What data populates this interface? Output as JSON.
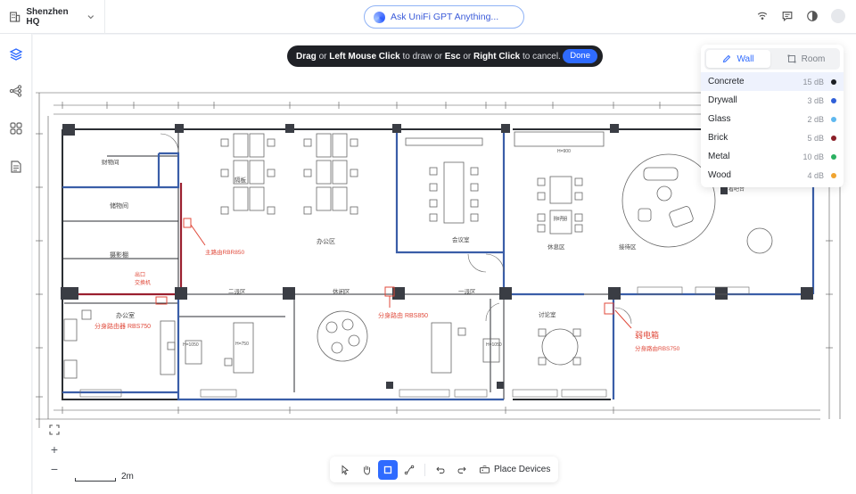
{
  "header": {
    "site_name": "Shenzhen HQ",
    "assistant_placeholder": "Ask UniFi GPT Anything...",
    "icons": [
      "building-icon",
      "chevron-down-icon",
      "signal-icon",
      "chat-icon",
      "theme-icon",
      "avatar"
    ]
  },
  "hint": {
    "part1": "Drag",
    "part2": " or ",
    "part3": "Left Mouse Click",
    "part4": " to draw or ",
    "part5": "Esc",
    "part6": " or ",
    "part7": "Right Click",
    "part8": " to cancel.",
    "done_label": "Done"
  },
  "panel": {
    "tabs": [
      {
        "label": "Wall",
        "icon": "pencil-icon",
        "active": true
      },
      {
        "label": "Room",
        "icon": "room-icon",
        "active": false
      }
    ],
    "materials": [
      {
        "name": "Concrete",
        "db": "15 dB",
        "color": "#1c1f24",
        "selected": true
      },
      {
        "name": "Drywall",
        "db": "3 dB",
        "color": "#2f5fd8",
        "selected": false
      },
      {
        "name": "Glass",
        "db": "2 dB",
        "color": "#5fb8ef",
        "selected": false
      },
      {
        "name": "Brick",
        "db": "5 dB",
        "color": "#8b1f28",
        "selected": false
      },
      {
        "name": "Metal",
        "db": "10 dB",
        "color": "#2bb061",
        "selected": false
      },
      {
        "name": "Wood",
        "db": "4 dB",
        "color": "#f0a430",
        "selected": false
      }
    ]
  },
  "plan": {
    "labels": {
      "storage": "财物间",
      "store_room": "储物间",
      "photo_room": "摄影棚",
      "office_room": "办公室",
      "office_area": "办公区",
      "meeting_room": "会议室",
      "rest_area": "休息区",
      "reception": "接待区",
      "bar": "看吧台",
      "zone2": "二派区",
      "rest2": "休闲区",
      "zone1": "一派区",
      "discuss": "讨论室",
      "inner": "隔板",
      "main_router": "主路由RBR850",
      "exit": "出口",
      "switch": "交换机",
      "sub_router_a": "分身路由器 RBS750",
      "sub_router_b": "分身路由 RBS850",
      "weak_box": "弱电箱",
      "sub_router_c": "分身路由RBS750",
      "h750a": "H=750",
      "h750b": "H=750",
      "h750c": "H=750",
      "h1050a": "H=1050",
      "h1050b": "H=1050",
      "h900": "H=900"
    }
  },
  "zoom": {
    "in": "+",
    "out": "−"
  },
  "scale": {
    "label": "2m"
  },
  "toolbar": {
    "place_label": "Place Devices"
  }
}
